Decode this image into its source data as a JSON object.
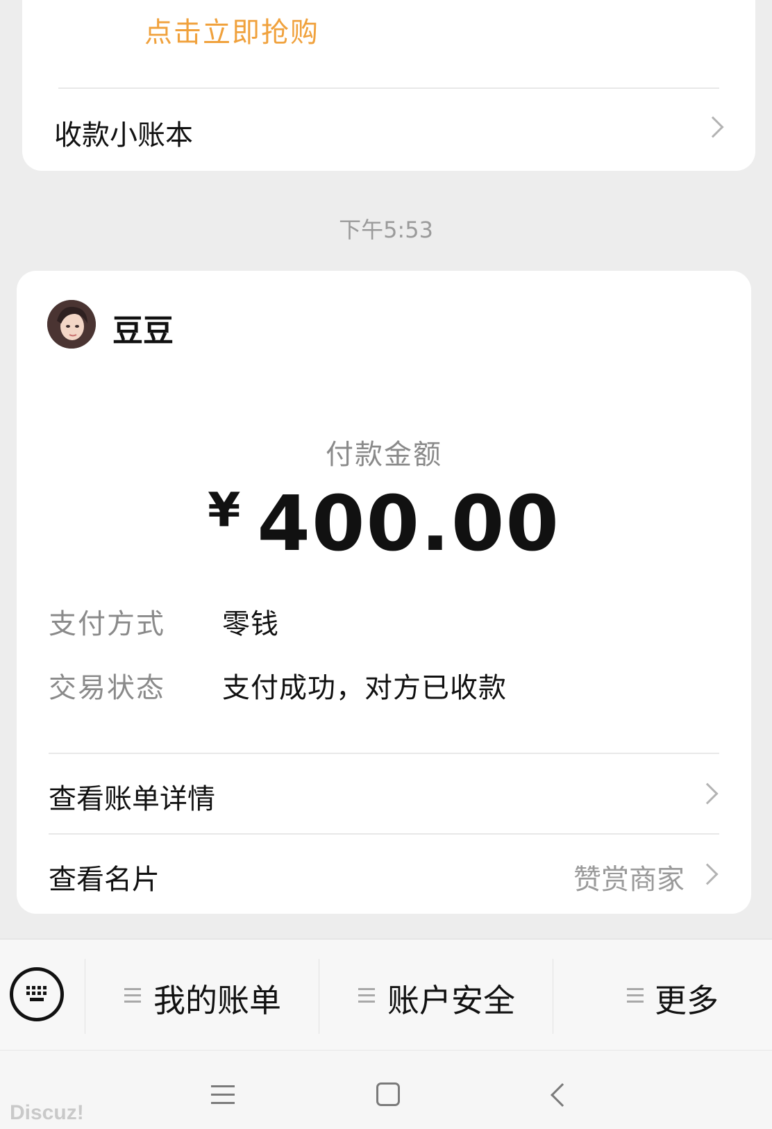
{
  "top_card": {
    "promo_text": "点击立即抢购",
    "ledger_label": "收款小账本"
  },
  "time_label": "下午5:53",
  "payment": {
    "payee_name": "豆豆",
    "amount_label": "付款金额",
    "currency_symbol": "¥",
    "amount": "400.00",
    "method_label": "支付方式",
    "method_value": "零钱",
    "status_label": "交易状态",
    "status_value": "支付成功，对方已收款",
    "bill_detail_label": "查看账单详情",
    "card_label": "查看名片",
    "reward_label": "赞赏商家"
  },
  "menu_bar": {
    "items": [
      {
        "label": "我的账单",
        "icon": "menu-lines-icon"
      },
      {
        "label": "账户安全",
        "icon": "menu-lines-icon"
      },
      {
        "label": "更多",
        "icon": "menu-lines-icon"
      }
    ],
    "keyboard_icon": "keyboard-icon"
  },
  "system_nav": {
    "icons": [
      "menu-icon",
      "home-icon",
      "back-icon"
    ]
  },
  "watermark": "Discuz!",
  "colors": {
    "background": "#ededed",
    "card": "#ffffff",
    "promo": "#f0a13c",
    "muted_text": "#8a8a8a"
  }
}
